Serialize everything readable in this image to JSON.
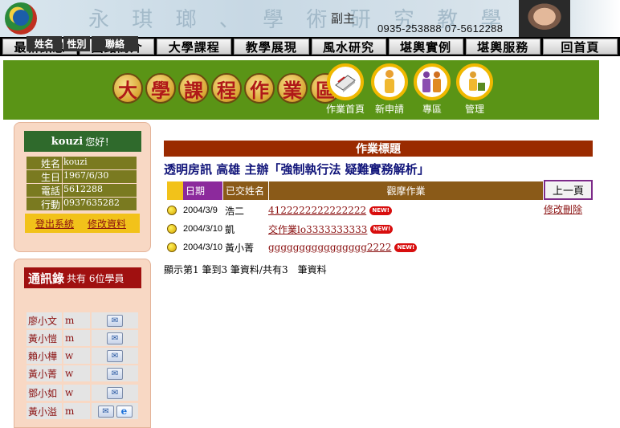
{
  "banner": {
    "title_chars": "永 琪 瑯 、 學 術 研 究 教 學",
    "zhu": "副主",
    "phone": "0935-253888  07-5612288"
  },
  "nav": [
    "最新訊息",
    "圖銘簡介",
    "大學課程",
    "教學展現",
    "風水研究",
    "堪輿實例",
    "堪輿服務",
    "回首頁"
  ],
  "header": {
    "title_chars": [
      "大",
      "學",
      "課",
      "程",
      "作",
      "業",
      "區"
    ],
    "buttons": [
      {
        "label": "作業首頁",
        "icon": "homework-home-icon"
      },
      {
        "label": "新申請",
        "icon": "new-application-icon"
      },
      {
        "label": "專區",
        "icon": "zone-icon"
      },
      {
        "label": "管理",
        "icon": "manage-icon"
      }
    ]
  },
  "user": {
    "name": "kouzi",
    "greeting": "您好！",
    "fields": [
      {
        "label": "姓名",
        "value": "kouzi"
      },
      {
        "label": "生日",
        "value": "1967/6/30"
      },
      {
        "label": "電話",
        "value": "5612288"
      },
      {
        "label": "行動",
        "value": "0937635282"
      }
    ],
    "logout_label": "登出系統",
    "edit_profile_label": "修改資料"
  },
  "contacts": {
    "title": "通訊錄",
    "count_text": "共有 6位學員",
    "headers": {
      "name": "姓名",
      "gender": "性別",
      "contact": "聯絡"
    },
    "rows": [
      {
        "name": "廖小文",
        "gender": "m",
        "ie": false
      },
      {
        "name": "黃小愷",
        "gender": "m",
        "ie": false
      },
      {
        "name": "賴小樺",
        "gender": "w",
        "ie": false
      },
      {
        "name": "黃小菁",
        "gender": "w",
        "ie": false
      },
      {
        "name": "鄧小如",
        "gender": "w",
        "ie": false
      },
      {
        "name": "黃小溢",
        "gender": "m",
        "ie": true
      }
    ]
  },
  "main": {
    "section_title": "作業標題",
    "course_title": "透明房訊 高雄 主辦「強制執行法 疑難實務解析」",
    "table_headers": {
      "date": "日期",
      "submitter": "已交姓名",
      "view": "觀摩作業"
    },
    "back_label": "上一頁",
    "edit_delete_label": "修改刪除",
    "new_badge": "NEW!",
    "rows": [
      {
        "date": "2004/3/9",
        "name": "浩二",
        "title": "4122222222222222"
      },
      {
        "date": "2004/3/10",
        "name": "凱",
        "title": "交作業lo3333333333"
      },
      {
        "date": "2004/3/10",
        "name": "黃小菁",
        "title": "gggggggggggggggg2222"
      }
    ],
    "summary": "顯示第1 筆到3 筆資料/共有3　筆資料"
  },
  "colors": {
    "header_green": "#5a9416",
    "section_brown": "#9a2a00",
    "course_blue": "#11157a",
    "link_red": "#8a1010",
    "contacts_red": "#a01010",
    "user_green": "#2f6a2c",
    "olive": "#7a7a20"
  }
}
